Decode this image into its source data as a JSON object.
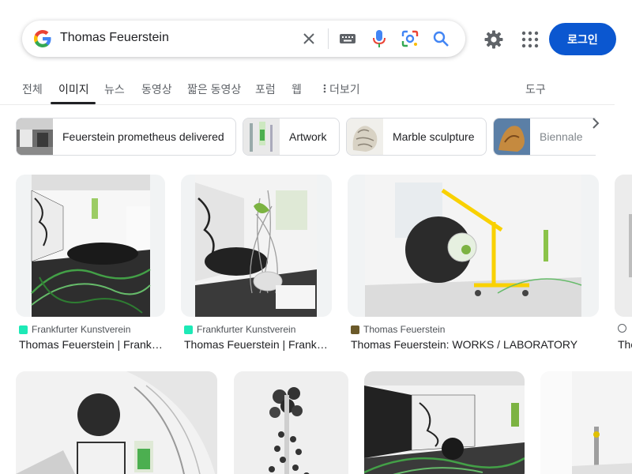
{
  "search": {
    "query": "Thomas Feuerstein",
    "icons": [
      "google-g-icon",
      "clear-icon",
      "keyboard-icon",
      "microphone-icon",
      "lens-icon",
      "search-icon"
    ]
  },
  "header": {
    "login_label": "로그인",
    "icons": [
      "gear-icon",
      "apps-grid-icon"
    ]
  },
  "tabs": [
    {
      "label": "전체"
    },
    {
      "label": "이미지",
      "active": true
    },
    {
      "label": "뉴스"
    },
    {
      "label": "동영상"
    },
    {
      "label": "짧은 동영상"
    },
    {
      "label": "포럼"
    },
    {
      "label": "웹"
    },
    {
      "label": "더보기"
    },
    {
      "label": "도구"
    }
  ],
  "chips": [
    {
      "label": "Feuerstein prometheus delivered"
    },
    {
      "label": "Artwork"
    },
    {
      "label": "Marble sculpture"
    },
    {
      "label": "Biennale"
    }
  ],
  "results": [
    {
      "source": "Frankfurter Kunstverein",
      "title": "Thomas Feuerstein | Frankfurter Kunstverein"
    },
    {
      "source": "Frankfurter Kunstverein",
      "title": "Thomas Feuerstein | Frankfurter Kunstverein"
    },
    {
      "source": "Thomas Feuerstein",
      "title": "Thomas Feuerstein: WORKS / LABORATORY"
    },
    {
      "source": "",
      "title": "Tho"
    }
  ],
  "colors": {
    "accent": "#0b57d0",
    "favicon_kunstverein": "#1de9b6"
  }
}
